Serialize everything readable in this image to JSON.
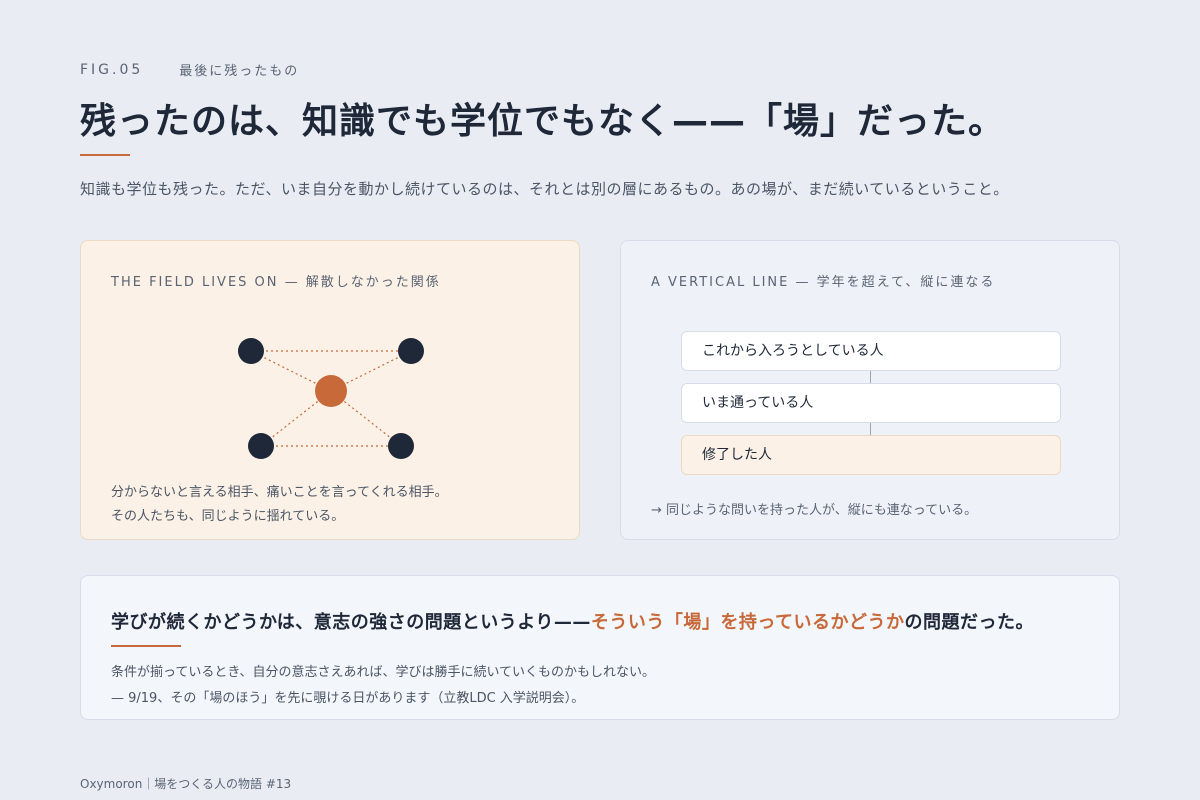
{
  "header": {
    "fig_number": "FIG.05",
    "fig_subtitle": "最後に残ったもの",
    "headline": "残ったのは、知識でも学位でもなく——「場」だった。",
    "lead": "知識も学位も残った。ただ、いま自分を動かし続けているのは、それとは別の層にあるもの。あの場が、まだ続いているということ。"
  },
  "left_card": {
    "title": "THE FIELD LIVES ON — 解散しなかった関係",
    "caption_line1": "分からないと言える相手、痛いことを言ってくれる相手。",
    "caption_line2": "その人たちも、同じように揺れている。"
  },
  "right_card": {
    "title": "A VERTICAL LINE — 学年を超えて、縦に連なる",
    "items": [
      {
        "label": "これから入ろうとしている人"
      },
      {
        "label": "いま通っている人"
      },
      {
        "label": "修了した人"
      }
    ],
    "note": "→ 同じような問いを持った人が、縦にも連なっている。"
  },
  "conclusion": {
    "part1": "学びが続くかどうかは、意志の強さの問題というより——",
    "highlight": "そういう「場」を持っているかどうか",
    "part2": "の問題だった。",
    "line1": "条件が揃っているとき、自分の意志さえあれば、学びは勝手に続いていくものかもしれない。",
    "line2": "— 9/19、その「場のほう」を先に覗ける日があります（立教LDC 入学説明会）。"
  },
  "footer": {
    "text": "Oxymoron｜場をつくる人の物語 #13"
  },
  "colors": {
    "accent": "#c8693a",
    "node_dark": "#1e2838",
    "background": "#e9edf3"
  }
}
